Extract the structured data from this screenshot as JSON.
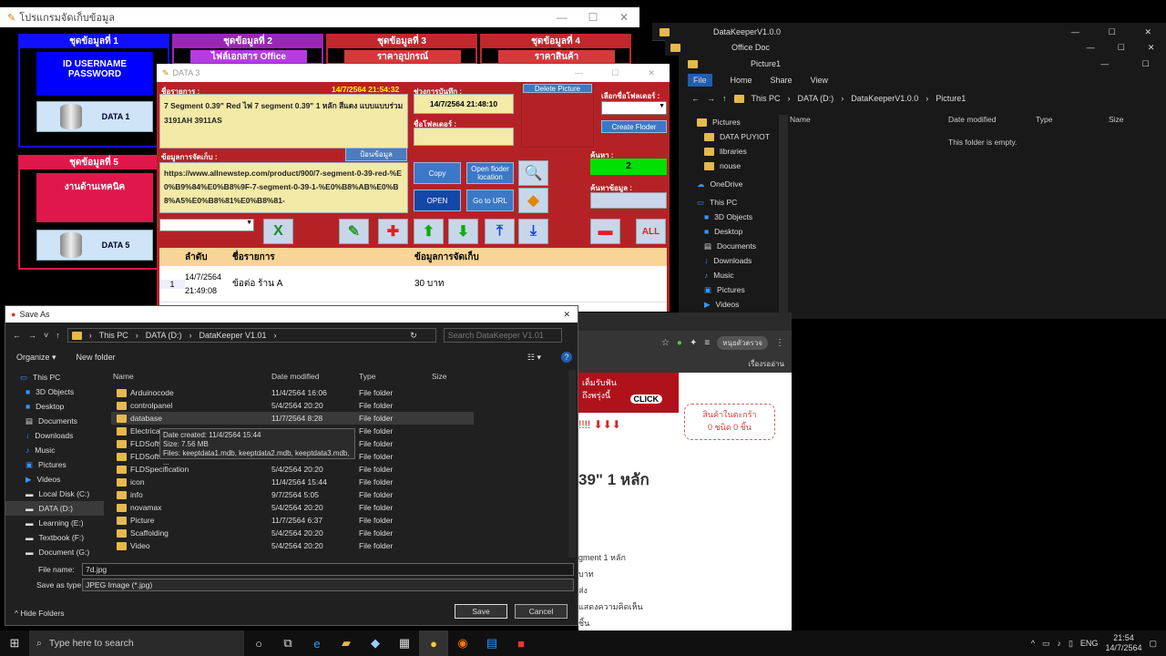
{
  "main_app": {
    "title": "โปรแกรมจัดเก็บข้อมูล",
    "groups": [
      {
        "title": "ชุดข้อมูลที่ 1",
        "btn": "ID USERNAME PASSWORD",
        "db": "DATA 1"
      },
      {
        "title": "ชุดข้อมูลที่ 2",
        "btn": "ไฟล์เอกสาร Office"
      },
      {
        "title": "ชุดข้อมูลที่ 3",
        "btn": "ราคาอุปกรณ์"
      },
      {
        "title": "ชุดข้อมูลที่ 4",
        "btn": "ราคาสินค้า"
      },
      {
        "title": "ชุดข้อมูลที่ 5",
        "btn": "งานด้านเทคนิค",
        "db": "DATA 5"
      }
    ]
  },
  "data3": {
    "title": "DATA 3",
    "item_label": "ชื่อรายการ :",
    "datetime": "14/7/2564 21:54:32",
    "item_text": "7 Segment 0.39\" Red ไฟ 7 segment 0.39\" 1 หลัก สีแดง แบบแบบร่วม 3191AH 3911AS",
    "saved_label": "ช่วงการบันทึก :",
    "saved_value": "14/7/2564 21:48:10",
    "folder_name_label": "ชื่อโฟลเดอร์ :",
    "delete_picture": "Delete Picture",
    "choose_folder_label": "เลือกชื่อโฟลเดอร์ :",
    "create_folder": "Create Floder",
    "info_label": "ข้อมูลการจัดเก็บ :",
    "fill_btn": "ป้อนข้อมูล",
    "info_text": "https://www.allnewstep.com/product/900/7-segment-0-39-red-%E0%B9%84%E0%B8%9F-7-segment-0-39-1-%E0%B8%AB%E0%B8%A5%E0%B8%81%E0%B8%81-",
    "copy": "Copy",
    "open_folder": "Open floder location",
    "open": "OPEN",
    "go_url": "Go to URL",
    "search_label": "ค้นหา :",
    "search_count": "2",
    "search_data_label": "ค้นหาข้อมูล :",
    "table": {
      "headers": [
        "ลำดับ",
        "ชื่อรายการ",
        "ข้อมูลการจัดเก็บ"
      ],
      "rows": [
        {
          "num": "1",
          "date": "14/7/2564",
          "time": "21:49:08",
          "name": "ข้อต่อ ร้าน A",
          "info": "30 บาท"
        }
      ]
    }
  },
  "explorer1": {
    "title": "DataKeeperV1.0.0"
  },
  "explorer2": {
    "title": "Office Doc"
  },
  "explorer3": {
    "title": "Picture1",
    "tabs": [
      "File",
      "Home",
      "Share",
      "View"
    ],
    "path": [
      "This PC",
      "DATA (D:)",
      "DataKeeperV1.0.0",
      "Picture1"
    ],
    "columns": [
      "Name",
      "Date modified",
      "Type",
      "Size"
    ],
    "empty": "This folder is empty.",
    "sidebar": [
      "Pictures",
      "DATA PUYIOT",
      "libraries",
      "nouse",
      "OneDrive",
      "This PC",
      "3D Objects",
      "Desktop",
      "Documents",
      "Downloads",
      "Music",
      "Pictures",
      "Videos"
    ]
  },
  "browser": {
    "profile": "หนุยตัวตรวจ",
    "reading_list": "เรื่องรออ่าน",
    "banner_click": "CLICK",
    "banner_text1": "เต็มรับฟัน",
    "banner_text2": "ถึงพรุ่งนี้",
    "heading_frag": "39\" 1 หลัก",
    "cart": "สินค้าในตะกร้า\n0 ชนิด 0 ชิ้น",
    "frag1": "gment 1 หลัก",
    "frag2": "บาท",
    "frag3": "ส่ง",
    "frag4": "แสดงความคิดเห็น",
    "frag5": "ชิ้น"
  },
  "saveas": {
    "title": "Save As",
    "path": [
      "This PC",
      "DATA (D:)",
      "DataKeeper V1.01"
    ],
    "search_placeholder": "Search DataKeeper V1.01",
    "organize": "Organize ▾",
    "new_folder": "New folder",
    "columns": [
      "Name",
      "Date modified",
      "Type",
      "Size"
    ],
    "sidebar": [
      "This PC",
      "3D Objects",
      "Desktop",
      "Documents",
      "Downloads",
      "Music",
      "Pictures",
      "Videos",
      "Local Disk (C:)",
      "DATA (D:)",
      "Learning (E:)",
      "Textbook (F:)",
      "Document (G:)"
    ],
    "files": [
      {
        "name": "Arduinocode",
        "date": "11/4/2564 16:06",
        "type": "File folder"
      },
      {
        "name": "controlpanel",
        "date": "5/4/2564 20:20",
        "type": "File folder"
      },
      {
        "name": "database",
        "date": "11/7/2564 8:28",
        "type": "File folder"
      },
      {
        "name": "ElectricalD",
        "date": "",
        "type": "File folder"
      },
      {
        "name": "FLDSoftwa",
        "date": "",
        "type": "File folder"
      },
      {
        "name": "FLDSoftwa",
        "date": "",
        "type": "File folder"
      },
      {
        "name": "FLDSpecification",
        "date": "5/4/2564 20:20",
        "type": "File folder"
      },
      {
        "name": "icon",
        "date": "11/4/2564 15:44",
        "type": "File folder"
      },
      {
        "name": "info",
        "date": "9/7/2564 5:05",
        "type": "File folder"
      },
      {
        "name": "novamax",
        "date": "5/4/2564 20:20",
        "type": "File folder"
      },
      {
        "name": "Picture",
        "date": "11/7/2564 6:37",
        "type": "File folder"
      },
      {
        "name": "Scaffolding",
        "date": "5/4/2564 20:20",
        "type": "File folder"
      },
      {
        "name": "Video",
        "date": "5/4/2564 20:20",
        "type": "File folder"
      }
    ],
    "tooltip": [
      "Date created: 11/4/2564 15:44",
      "Size: 7.56 MB",
      "Files: keeptdata1.mdb, keeptdata2.mdb, keeptdata3.mdb, ..."
    ],
    "file_name_label": "File name:",
    "file_name": "7d.jpg",
    "save_type_label": "Save as type:",
    "save_type": "JPEG Image (*.jpg)",
    "hide_folders": "Hide Folders",
    "save": "Save",
    "cancel": "Cancel"
  },
  "taskbar": {
    "search": "Type here to search",
    "lang": "ENG",
    "time": "21:54",
    "date": "14/7/2564"
  }
}
